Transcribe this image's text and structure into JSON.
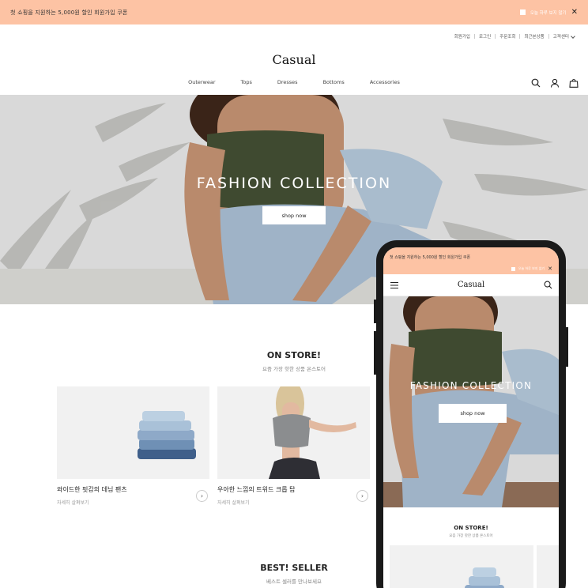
{
  "promo": {
    "text": "첫 쇼핑을 지원하는 5,000원 할인 회원가입 쿠폰",
    "checkbox_label": "오늘 하루 보지 않기",
    "close": "✕"
  },
  "util_links": [
    "회원가입",
    "로그인",
    "주문조회",
    "최근본상품",
    "고객센터"
  ],
  "brand": "Casual",
  "nav": [
    "Outerwear",
    "Tops",
    "Dresses",
    "Bottoms",
    "Accessories"
  ],
  "header_icons": [
    "search-icon",
    "user-icon",
    "shopping-bag-icon"
  ],
  "hero": {
    "title": "FASHION COLLECTION",
    "button": "shop now"
  },
  "on_store": {
    "title": "ON STORE!",
    "subtitle": "요즘 가장 핫한 상품 온스토어",
    "products": [
      {
        "name": "와이드한 핏감의 데님 팬츠",
        "more": "자세히 살펴보기"
      },
      {
        "name": "우아한 느낌의 트위드 크롭 탑",
        "more": "자세히 살펴보기"
      }
    ]
  },
  "best_seller": {
    "title": "BEST! SELLER",
    "subtitle": "베스트 셀러를 만나보세요"
  },
  "mobile": {
    "promo_text": "첫 쇼핑을 지원하는 5,000원 할인 회원가입 쿠폰",
    "checkbox_label": "오늘 하루 보지 않기",
    "close": "✕",
    "brand": "Casual",
    "hero_title": "FASHION COLLECTION",
    "hero_button": "shop now",
    "section_title": "ON STORE!",
    "section_subtitle": "요즘 가장 핫한 상품 온스토어"
  },
  "colors": {
    "promo_bg": "#fdc3a4",
    "text": "#222222",
    "muted": "#888888"
  }
}
